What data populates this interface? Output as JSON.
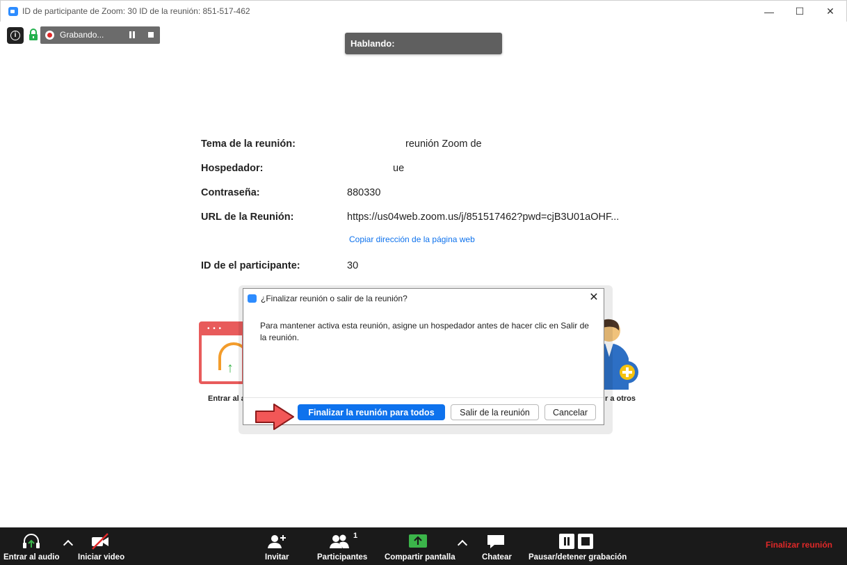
{
  "titlebar": {
    "title": "ID de participante de Zoom: 30    ID de la reunión: 851-517-462",
    "minimize": "—",
    "maximize": "☐",
    "close": "✕"
  },
  "status": {
    "info": "i",
    "recording_label": "Grabando..."
  },
  "speaking_label": "Hablando:",
  "meeting_info": {
    "topic_label": "Tema de la reunión:",
    "topic_value": "reunión Zoom de",
    "host_label": "Hospedador:",
    "host_value": "ue",
    "password_label": "Contraseña:",
    "password_value": "880330",
    "url_label": "URL de la Reunión:",
    "url_value": "https://us04web.zoom.us/j/851517462?pwd=cjB3U01aOHF...",
    "copy_link": "Copiar dirección de la página web",
    "participant_label": "ID de el participante:",
    "participant_value": "30"
  },
  "background_cards": {
    "left_label": "Entrar al a",
    "right_label": "r a otros"
  },
  "dialog": {
    "title": "¿Finalizar reunión o salir de la reunión?",
    "message": "Para mantener activa esta reunión, asigne un hospedador antes de hacer clic en Salir de la reunión.",
    "end_for_all": "Finalizar la reunión para todos",
    "leave": "Salir de la reunión",
    "cancel": "Cancelar"
  },
  "toolbar": {
    "audio": "Entrar al audio",
    "video": "Iniciar video",
    "invite": "Invitar",
    "participants": "Participantes",
    "participants_count": "1",
    "share": "Compartir pantalla",
    "chat": "Chatear",
    "recording": "Pausar/detener grabación",
    "end": "Finalizar reunión"
  },
  "colors": {
    "primary": "#0e72ed",
    "danger": "#e02828",
    "toolbar_bg": "#1a1a1a",
    "share_green": "#3bb54a"
  }
}
